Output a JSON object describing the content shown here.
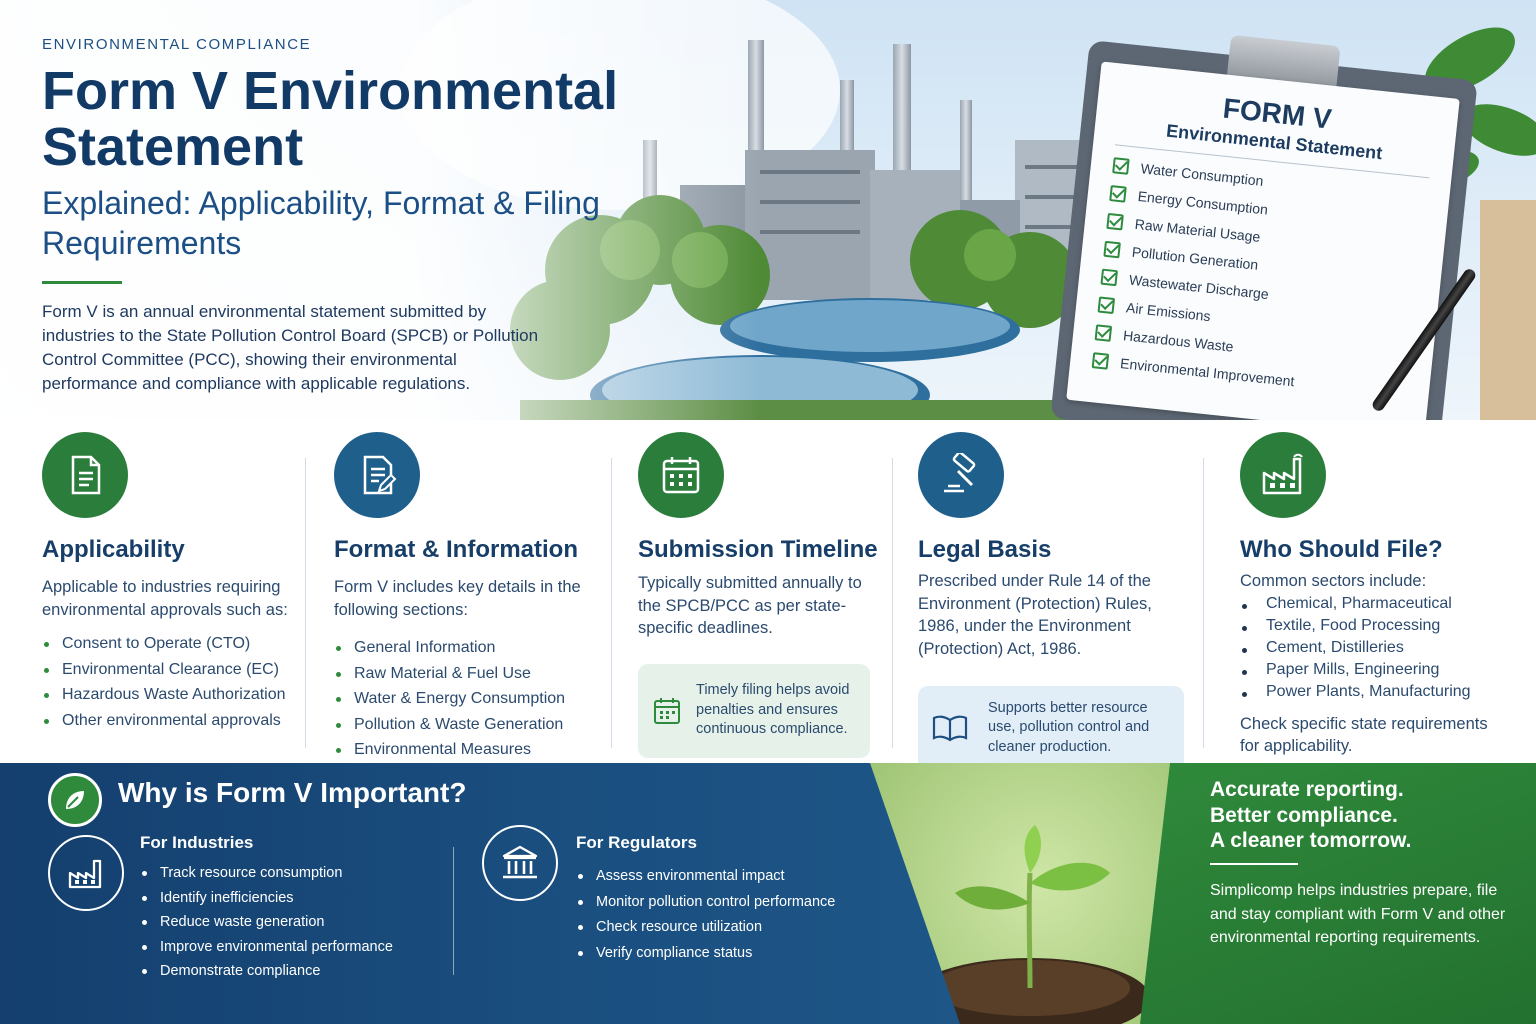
{
  "hero": {
    "eyebrow": "ENVIRONMENTAL COMPLIANCE",
    "title_line1": "Form V Environmental",
    "title_line2": "Statement",
    "subtitle": "Explained: Applicability, Format & Filing Requirements",
    "intro": "Form V is an annual environmental statement submitted by industries to the State Pollution Control Board (SPCB) or Pollution Control Committee (PCC), showing their environmental performance and compliance with applicable regulations."
  },
  "clipboard": {
    "title": "FORM V",
    "subtitle": "Environmental Statement",
    "items": [
      "Water Consumption",
      "Energy Consumption",
      "Raw Material Usage",
      "Pollution Generation",
      "Wastewater Discharge",
      "Air Emissions",
      "Hazardous Waste",
      "Environmental Improvement"
    ]
  },
  "cards": {
    "applicability": {
      "icon": "document-icon",
      "title": "Applicability",
      "body": "Applicable to industries requiring environmental approvals such as:",
      "bullets": [
        "Consent to Operate (CTO)",
        "Environmental Clearance (EC)",
        "Hazardous Waste Authorization",
        "Other environmental approvals"
      ]
    },
    "format": {
      "icon": "form-edit-icon",
      "title": "Format & Information",
      "body": "Form V includes key details in the following sections:",
      "bullets": [
        "General Information",
        "Raw Material & Fuel Use",
        "Water & Energy Consumption",
        "Pollution & Waste Generation",
        "Environmental Measures"
      ]
    },
    "timeline": {
      "icon": "calendar-icon",
      "title": "Submission Timeline",
      "body": "Typically submitted annually to the SPCB/PCC as per state-specific deadlines.",
      "note": "Timely filing helps avoid penalties and ensures continuous compliance."
    },
    "legal": {
      "icon": "gavel-icon",
      "title": "Legal Basis",
      "body": "Prescribed under Rule 14 of the Environment (Protection) Rules, 1986, under the Environment (Protection) Act, 1986.",
      "note": "Supports better resource use, pollution control and cleaner production."
    },
    "who": {
      "icon": "factory-icon",
      "title": "Who Should File?",
      "body": "Common sectors include:",
      "bullets": [
        "Chemical, Pharmaceutical",
        "Textile, Food Processing",
        "Cement, Distilleries",
        "Paper Mills, Engineering",
        "Power Plants, Manufacturing"
      ],
      "footer": "Check specific state requirements for applicability."
    }
  },
  "why": {
    "title": "Why is Form V Important?",
    "industries": {
      "heading": "For Industries",
      "bullets": [
        "Track resource consumption",
        "Identify inefficiencies",
        "Reduce waste generation",
        "Improve environmental performance",
        "Demonstrate compliance"
      ]
    },
    "regulators": {
      "heading": "For Regulators",
      "bullets": [
        "Assess environmental impact",
        "Monitor pollution control performance",
        "Check resource utilization",
        "Verify compliance status"
      ]
    }
  },
  "closing": {
    "tag1": "Accurate reporting.",
    "tag2": "Better compliance.",
    "tag3": "A cleaner tomorrow.",
    "body": "Simplicomp helps industries prepare, file and stay compliant with Form V and other environmental reporting requirements."
  },
  "colors": {
    "navy": "#123a66",
    "green": "#2e8b3e",
    "blue": "#1e5f8c"
  }
}
